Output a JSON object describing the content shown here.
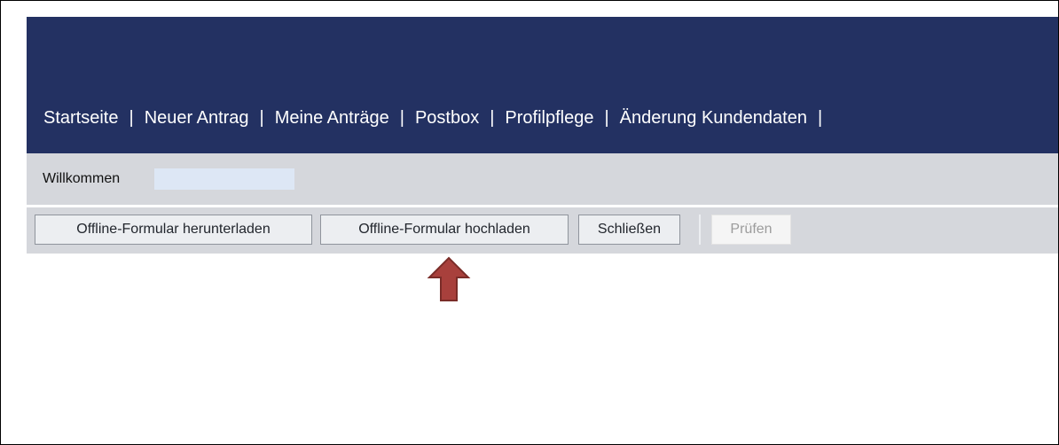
{
  "nav": {
    "items": [
      {
        "label": "Startseite"
      },
      {
        "label": "Neuer Antrag"
      },
      {
        "label": "Meine Anträge"
      },
      {
        "label": "Postbox"
      },
      {
        "label": "Profilpflege"
      },
      {
        "label": "Änderung Kundendaten"
      }
    ],
    "separator": "|"
  },
  "welcome": {
    "label": "Willkommen"
  },
  "toolbar": {
    "download_label": "Offline-Formular herunterladen",
    "upload_label": "Offline-Formular hochladen",
    "close_label": "Schließen",
    "check_label": "Prüfen"
  },
  "icons": {
    "annotation": "up-arrow-icon"
  },
  "colors": {
    "header_bg": "#233162",
    "bar_bg": "#d5d7dc",
    "arrow_fill": "#a8403c"
  }
}
